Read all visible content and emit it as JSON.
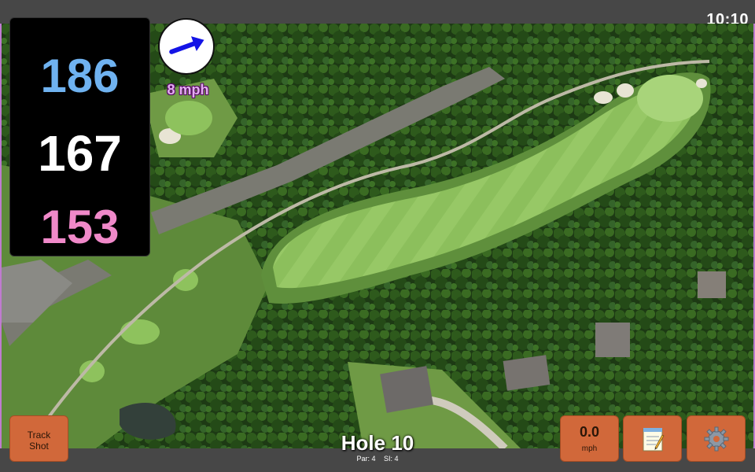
{
  "status": {
    "time": "10:10"
  },
  "distances": {
    "back": "186",
    "middle": "167",
    "front": "153"
  },
  "wind": {
    "speed_label": "8 mph",
    "direction": "east-northeast"
  },
  "buttons": {
    "track_shot_line1": "Track",
    "track_shot_line2": "Shot",
    "speed_value": "0.0",
    "speed_unit": "mph",
    "notes_icon": "notepad-icon",
    "settings_icon": "gear-icon"
  },
  "hole": {
    "title": "Hole 10",
    "par_label": "Par: 4",
    "si_label": "SI: 4"
  },
  "colors": {
    "back_distance": "#6fb2f0",
    "middle_distance": "#ffffff",
    "front_distance": "#f089c9",
    "button_bg": "#d1683a",
    "wind_arrow": "#1414e6"
  }
}
